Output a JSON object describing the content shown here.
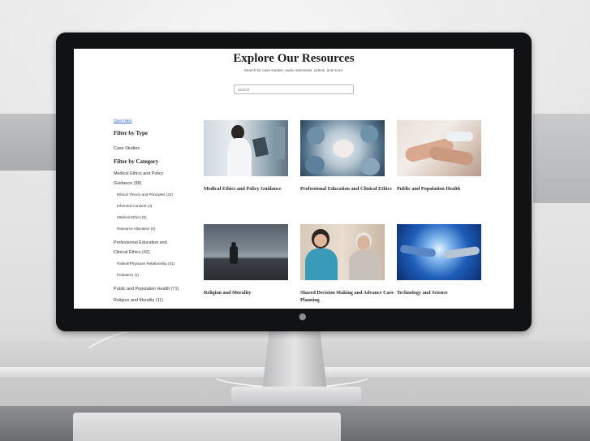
{
  "page": {
    "title": "Explore Our Resources",
    "subtitle": "Search for case studies, audio interviews, videos, and more.",
    "search_placeholder": "Search"
  },
  "filters": {
    "clear_label": "Clear Filters",
    "by_type_heading": "Filter by Type",
    "type_items": [
      "Case Studies"
    ],
    "by_category_heading": "Filter by Category",
    "category_items": [
      {
        "label": "Medical Ethics and Policy",
        "level": "main"
      },
      {
        "label": "Guidance (38)",
        "level": "main"
      },
      {
        "label": "Ethical Theory and Principles (23)",
        "level": "sub"
      },
      {
        "label": "Informed Consent (4)",
        "level": "sub"
      },
      {
        "label": "Medical Ethics (9)",
        "level": "sub"
      },
      {
        "label": "Resource Allocation (6)",
        "level": "sub"
      },
      {
        "label": "Professional Education and",
        "level": "main"
      },
      {
        "label": "Clinical Ethics (42)",
        "level": "main"
      },
      {
        "label": "Patient/Physician Relationship (41)",
        "level": "sub"
      },
      {
        "label": "Pediatrics (1)",
        "level": "sub"
      },
      {
        "label": "Public and Population Health (71)",
        "level": "main"
      },
      {
        "label": "Religion and Morality (11)",
        "level": "main"
      }
    ]
  },
  "cards": [
    {
      "title": "Medical Ethics and Policy Guidance",
      "image": "doctor-with-tablet-photo"
    },
    {
      "title": "Professional Education and Clinical Ethics",
      "image": "surgeons-hands-together-photo"
    },
    {
      "title": "Public and Population Health",
      "image": "hands-holding-patient-photo"
    },
    {
      "title": "Religion and Morality",
      "image": "silhouette-dusk-photo"
    },
    {
      "title": "Shared Decision Making and Advance Care Planning",
      "image": "nurse-with-elderly-patient-photo"
    },
    {
      "title": "Technology and Science",
      "image": "robot-human-hand-photo"
    }
  ],
  "colors": {
    "link": "#2a62c9",
    "monitor_bezel": "#111214",
    "screen_bg": "#ffffff"
  }
}
